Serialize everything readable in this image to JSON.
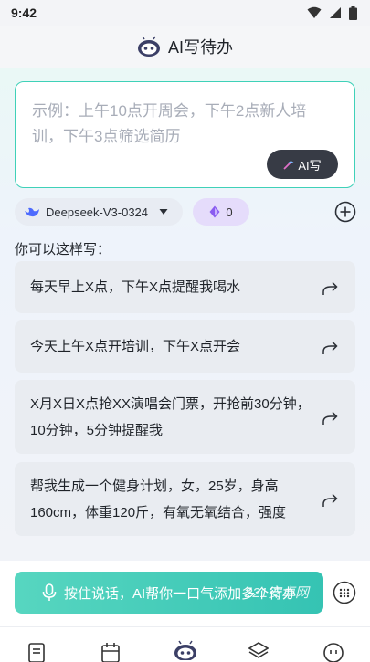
{
  "status_bar": {
    "time": "9:42"
  },
  "header": {
    "title": "AI写待办"
  },
  "input": {
    "placeholder": "示例：上午10点开周会，下午2点新人培训，下午3点筛选简历",
    "ai_write_label": "AI写"
  },
  "model": {
    "name": "Deepseek-V3-0324"
  },
  "tokens": {
    "count": "0"
  },
  "examples": {
    "title": "你可以这样写：",
    "items": [
      {
        "text": "每天早上X点，下午X点提醒我喝水"
      },
      {
        "text": "今天上午X点开培训，下午X点开会"
      },
      {
        "text": "X月X日X点抢XX演唱会门票，开抢前30分钟，10分钟，5分钟提醒我"
      },
      {
        "text": "帮我生成一个健身计划，女，25岁，身高160cm，体重120斤，有氧无氧结合，强度"
      }
    ]
  },
  "voice": {
    "label": "按住说话，AI帮你一口气添加多个待办"
  },
  "watermark": {
    "text": "221安卓网"
  },
  "colors": {
    "accent": "#3fd1b8",
    "voice_button": "#35c3b3",
    "ai_button": "#373b45",
    "token_pill": "#e5dcfb"
  }
}
